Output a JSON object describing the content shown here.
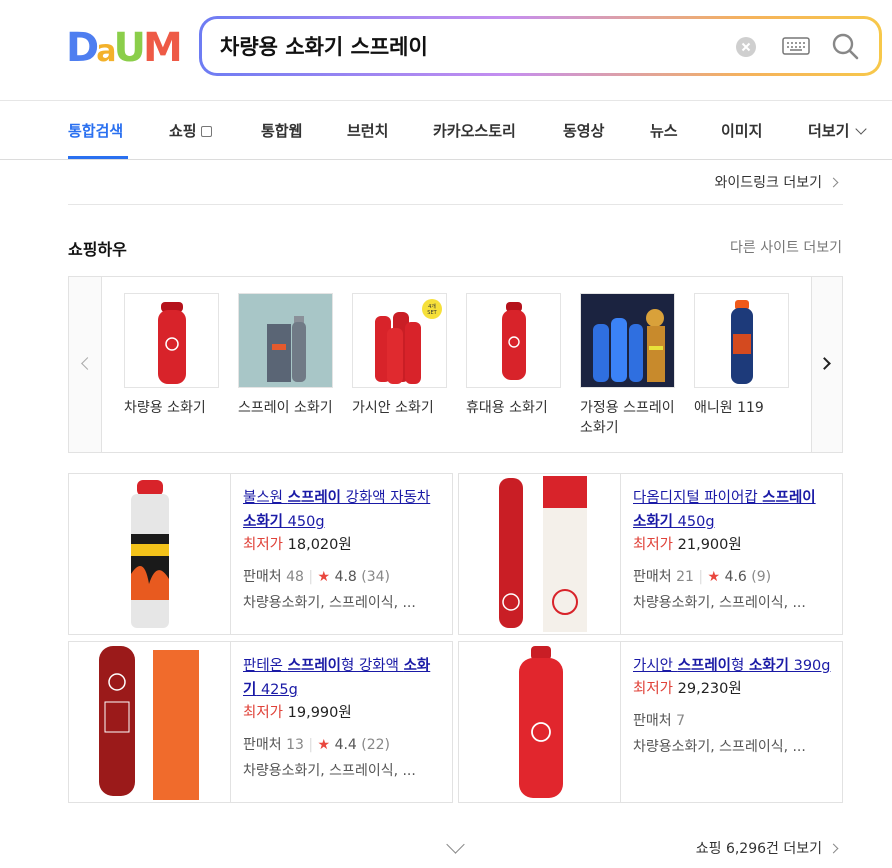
{
  "logo": {
    "letters": [
      "D",
      "a",
      "U",
      "M"
    ],
    "colors": [
      "#4e7ef0",
      "#f3b12a",
      "#8bce4a",
      "#ee5a46"
    ]
  },
  "search": {
    "query": "차량용 소화기 스프레이"
  },
  "tabs": [
    {
      "label": "통합검색",
      "active": true
    },
    {
      "label": "쇼핑",
      "active": false
    },
    {
      "label": "통합웹",
      "active": false
    },
    {
      "label": "브런치",
      "active": false
    },
    {
      "label": "카카오스토리",
      "active": false
    },
    {
      "label": "동영상",
      "active": false
    },
    {
      "label": "뉴스",
      "active": false
    },
    {
      "label": "이미지",
      "active": false
    },
    {
      "label": "더보기",
      "active": false
    }
  ],
  "wide_link": "와이드링크 더보기",
  "shopping_how": {
    "title": "쇼핑하우",
    "other_sites": "다른 사이트 더보기",
    "items": [
      {
        "label": "차량용 소화기"
      },
      {
        "label": "스프레이 소화기"
      },
      {
        "label": "가시안 소화기",
        "badge": "4개 SET"
      },
      {
        "label": "휴대용 소화기"
      },
      {
        "label": "가정용 스프레이 소화기"
      },
      {
        "label": "애니원 119"
      }
    ]
  },
  "products": [
    {
      "title_pre": "불스원 ",
      "title_hl": "스프레이",
      "title_mid": " 강화액 자동차 ",
      "title_hl2": "소화기",
      "title_post": " 450g",
      "price_label": "최저가",
      "price": "18,020원",
      "seller_label": "판매처",
      "seller_count": "48",
      "rating": "4.8",
      "reviews": "(34)",
      "tags": "차량용소화기, 스프레이식, ..."
    },
    {
      "title_pre": "다옴디지털 파이어캅 ",
      "title_hl": "스프레이",
      "title_mid": " ",
      "title_hl2": "소화기",
      "title_post": " 450g",
      "price_label": "최저가",
      "price": "21,900원",
      "seller_label": "판매처",
      "seller_count": "21",
      "rating": "4.6",
      "reviews": "(9)",
      "tags": "차량용소화기, 스프레이식, ..."
    },
    {
      "title_pre": "판테온 ",
      "title_hl": "스프레이",
      "title_mid": "형 강화액 ",
      "title_hl2": "소화기",
      "title_post": " 425g",
      "price_label": "최저가",
      "price": "19,990원",
      "seller_label": "판매처",
      "seller_count": "13",
      "rating": "4.4",
      "reviews": "(22)",
      "tags": "차량용소화기, 스프레이식, ..."
    },
    {
      "title_pre": "가시안 ",
      "title_hl": "스프레이",
      "title_mid": "형 ",
      "title_hl2": "소화기",
      "title_post": " 390g",
      "price_label": "최저가",
      "price": "29,230원",
      "seller_label": "판매처",
      "seller_count": "7",
      "rating": "",
      "reviews": "",
      "tags": "차량용소화기, 스프레이식, ..."
    }
  ],
  "shop_more": "쇼핑 6,296건 더보기"
}
